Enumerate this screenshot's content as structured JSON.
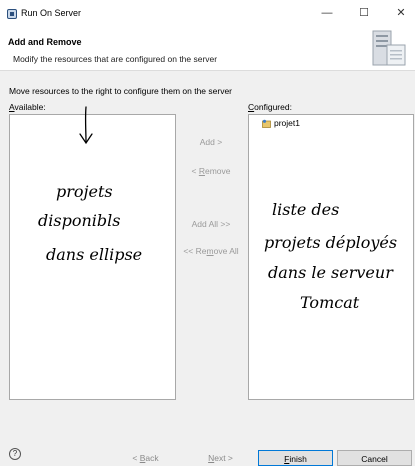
{
  "window": {
    "title": "Run On Server",
    "minimize": "—",
    "maximize": "☐",
    "close": "✕"
  },
  "header": {
    "title": "Add and Remove",
    "description": "Modify the resources that are configured on the server"
  },
  "main": {
    "instruction": "Move resources to the right to configure them on the server",
    "available_label_u": "A",
    "available_label_rest": "vailable:",
    "configured_label_u": "C",
    "configured_label_rest": "onfigured:",
    "configured_items": [
      "projet1"
    ],
    "buttons": {
      "add": "Add >",
      "remove_pre": "< ",
      "remove_u": "R",
      "remove_rest": "emove",
      "add_all": "Add All >>",
      "remove_all_pre": "<< Re",
      "remove_all_u": "m",
      "remove_all_rest": "ove All"
    }
  },
  "annotations": {
    "left": [
      "projets",
      "disponibls",
      "dans ellipse"
    ],
    "right": [
      "liste des",
      "projets déployés",
      "dans le serveur",
      "Tomcat"
    ]
  },
  "footer": {
    "help": "?",
    "back_pre": "< ",
    "back_u": "B",
    "back_rest": "ack",
    "next_u": "N",
    "next_rest": "ext >",
    "finish_u": "F",
    "finish_rest": "inish",
    "cancel": "Cancel"
  }
}
